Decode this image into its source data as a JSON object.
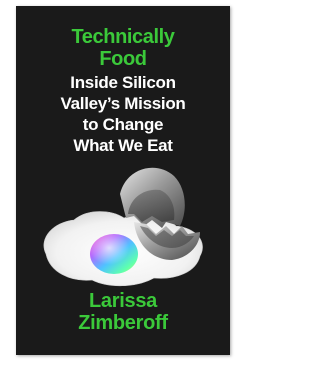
{
  "book": {
    "title_lines": [
      "Technically",
      "Food"
    ],
    "subtitle_lines": [
      "Inside Silicon",
      "Valley’s Mission",
      "to Change",
      "What We Eat"
    ],
    "author_lines": [
      "Larissa",
      "Zimberoff"
    ]
  },
  "colors": {
    "cover_background": "#1a1a1a",
    "accent_green": "#3bc93a",
    "subtitle_text": "#ffffff"
  },
  "artwork": {
    "description_icon": "cracked-egg-with-iridescent-yolk-icon"
  }
}
